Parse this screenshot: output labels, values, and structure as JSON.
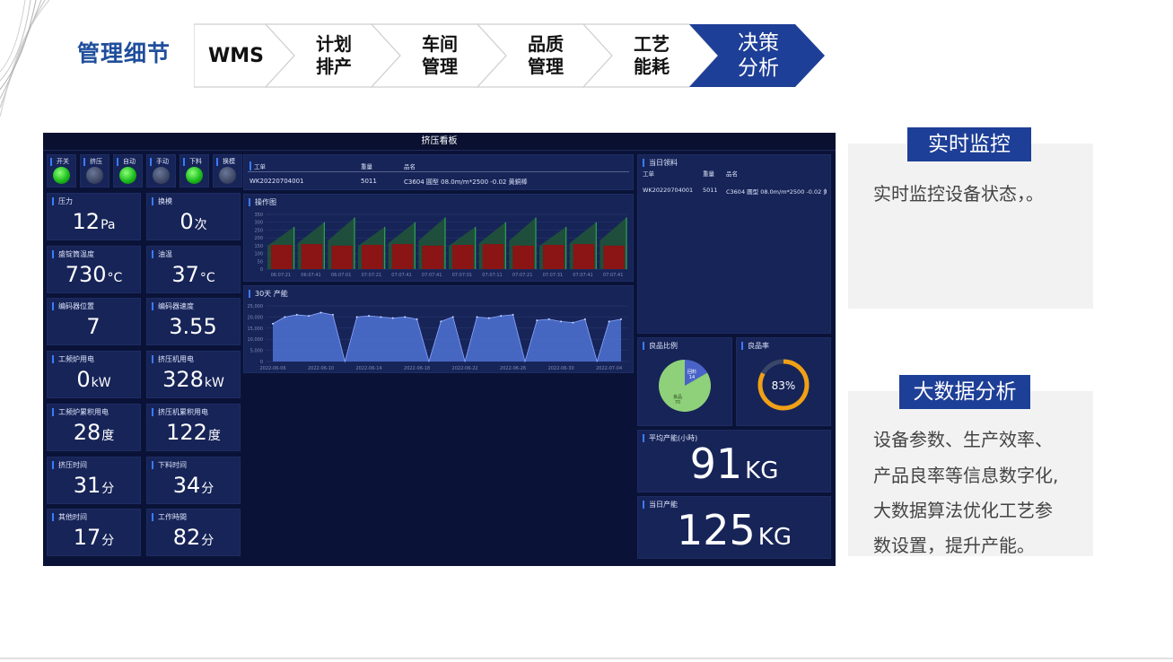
{
  "header": {
    "title": "管理细节"
  },
  "steps": [
    {
      "label": "WMS",
      "active": false
    },
    {
      "label": "计划\n排产",
      "active": false
    },
    {
      "label": "车间\n管理",
      "active": false
    },
    {
      "label": "品质\n管理",
      "active": false
    },
    {
      "label": "工艺\n能耗",
      "active": false
    },
    {
      "label": "决策\n分析",
      "active": true
    }
  ],
  "colors": {
    "accent": "#1e3f97",
    "dashboard_bg": "#0a1337",
    "panel_bg": "#172458",
    "bar_red": "#8b1414",
    "bar_green": "#1f4f3c",
    "area_blue": "#4f73d4",
    "donut_orange": "#f0a016"
  },
  "dashboard": {
    "title": "挤压看板",
    "indicators": [
      {
        "label": "开关",
        "lamp": "on"
      },
      {
        "label": "挤压",
        "lamp": "off"
      },
      {
        "label": "自动",
        "lamp": "on"
      },
      {
        "label": "手动",
        "lamp": "off"
      },
      {
        "label": "下料",
        "lamp": "on"
      },
      {
        "label": "换模",
        "lamp": "off"
      }
    ],
    "metrics": [
      {
        "label": "压力",
        "value": "12",
        "unit": "Pa"
      },
      {
        "label": "换模",
        "value": "0",
        "unit": "次"
      },
      {
        "label": "盛锭筒温度",
        "value": "730",
        "unit": "°C"
      },
      {
        "label": "油温",
        "value": "37",
        "unit": "°C"
      },
      {
        "label": "编码器位置",
        "value": "7",
        "unit": ""
      },
      {
        "label": "编码器速度",
        "value": "3.55",
        "unit": ""
      },
      {
        "label": "工频炉用电",
        "value": "0",
        "unit": "kW"
      },
      {
        "label": "挤压机用电",
        "value": "328",
        "unit": "kW"
      },
      {
        "label": "工频炉累积用电",
        "value": "28",
        "unit": "度"
      },
      {
        "label": "挤压机累积用电",
        "value": "122",
        "unit": "度"
      },
      {
        "label": "挤压时间",
        "value": "31",
        "unit": "分"
      },
      {
        "label": "下料时间",
        "value": "34",
        "unit": "分"
      },
      {
        "label": "其他时间",
        "value": "17",
        "unit": "分"
      },
      {
        "label": "工作時間",
        "value": "82",
        "unit": "分"
      }
    ],
    "orders": {
      "headers": [
        "工单",
        "重量",
        "品名"
      ],
      "rows": [
        [
          "WK20220704001",
          "5011",
          "C3604 圓型 08.0m/m*2500 -0.02 黄銅棒"
        ]
      ]
    },
    "daily_material": {
      "title": "当日领料",
      "headers": [
        "工单",
        "重量",
        "品名"
      ],
      "rows": [
        [
          "WK20220704001",
          "5011",
          "C3604 圓型 08.0m/m*2500 -0.02 黄銅"
        ]
      ]
    },
    "good_ratio": {
      "title": "良品比例",
      "slices": [
        {
          "name": "回料",
          "value": 14
        },
        {
          "name": "良品",
          "value": 70
        }
      ]
    },
    "good_rate": {
      "title": "良品率",
      "value": "83%",
      "fraction": 0.83
    },
    "avg_output": {
      "title": "平均产能(小時)",
      "value": "91",
      "unit": "KG"
    },
    "daily_output": {
      "title": "当日产能",
      "value": "125",
      "unit": "KG"
    }
  },
  "chart_data": [
    {
      "type": "bar",
      "title": "操作图",
      "ylim": [
        0,
        350
      ],
      "yticks": [
        "350",
        "300",
        "250",
        "200",
        "150",
        "100",
        "50",
        "0"
      ],
      "categories": [
        "06:07:21",
        "06:07:41",
        "06:07:01",
        "07:07:21",
        "07:07:41",
        "07:07:41",
        "07:07:01",
        "07:07:11",
        "07:07:21",
        "07:07:31",
        "07:07:41",
        "07:07:41"
      ],
      "series": [
        {
          "values": [
            155,
            160,
            150,
            155,
            160,
            150,
            155,
            160,
            150,
            155,
            160,
            150
          ]
        },
        {
          "values": [
            270,
            300,
            330,
            270,
            300,
            330,
            270,
            300,
            330,
            270,
            300,
            330
          ]
        }
      ],
      "grid": true
    },
    {
      "type": "area",
      "title": "30天 产能",
      "ylim": [
        0,
        25000
      ],
      "yticks": [
        "25,000",
        "20,000",
        "15,000",
        "10,000",
        "5,000",
        "0"
      ],
      "xticks": [
        "2022-06-06",
        "2022-06-10",
        "2022-06-14",
        "2022-06-18",
        "2022-06-22",
        "2022-06-26",
        "2022-06-30",
        "2022-07-04"
      ],
      "x": [
        "2022-06-06",
        "2022-06-07",
        "2022-06-08",
        "2022-06-09",
        "2022-06-10",
        "2022-06-11",
        "2022-06-12",
        "2022-06-13",
        "2022-06-14",
        "2022-06-15",
        "2022-06-16",
        "2022-06-17",
        "2022-06-18",
        "2022-06-19",
        "2022-06-20",
        "2022-06-21",
        "2022-06-22",
        "2022-06-23",
        "2022-06-24",
        "2022-06-25",
        "2022-06-26",
        "2022-06-27",
        "2022-06-28",
        "2022-06-29",
        "2022-06-30",
        "2022-07-01",
        "2022-07-02",
        "2022-07-03",
        "2022-07-04",
        "2022-07-05"
      ],
      "values": [
        17000,
        20000,
        21000,
        20500,
        22000,
        21000,
        0,
        20000,
        20500,
        20000,
        19500,
        20000,
        19000,
        0,
        18000,
        20000,
        0,
        20000,
        19500,
        20500,
        21000,
        0,
        18500,
        19000,
        18000,
        17500,
        19000,
        0,
        18000,
        19000
      ],
      "grid": true
    }
  ],
  "side": {
    "realtime": {
      "tag": "实时监控",
      "text": "实时监控设备状态，。"
    },
    "bigdata": {
      "tag": "大数据分析",
      "lines": [
        "设备参数、生产效率、",
        "产品良率等信息数字化,",
        "大数据算法优化工艺参",
        "数设置，提升产能。"
      ]
    }
  }
}
